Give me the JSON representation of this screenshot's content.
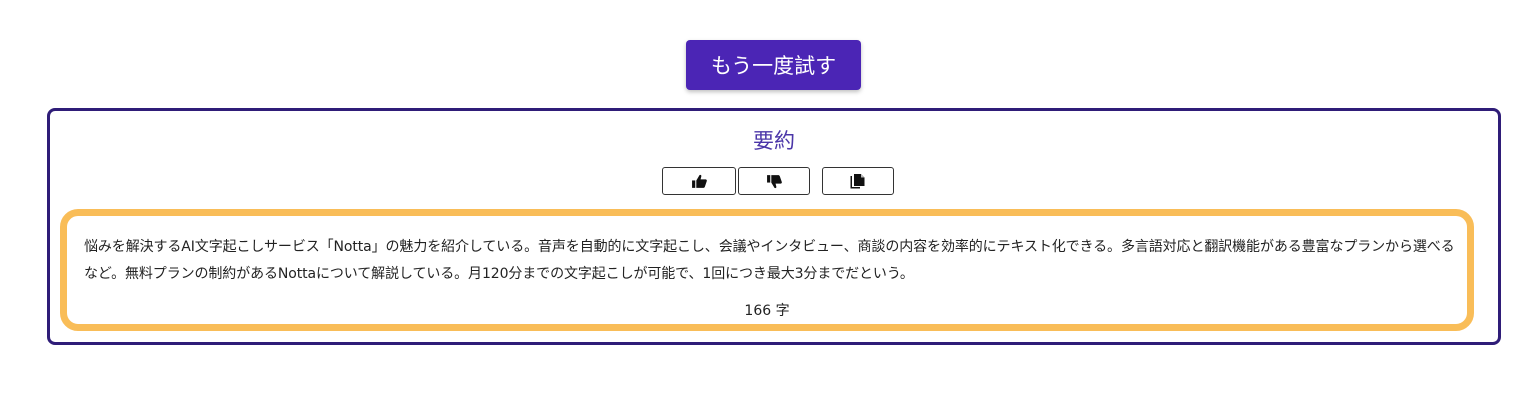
{
  "retry": {
    "label": "もう一度試す"
  },
  "summary": {
    "title": "要約",
    "text": "悩みを解決するAI文字起こしサービス「Notta」の魅力を紹介している。音声を自動的に文字起こし、会議やインタビュー、商談の内容を効率的にテキスト化できる。多言語対応と翻訳機能がある豊富なプランから選べるなど。無料プランの制約があるNottaについて解説している。月120分までの文字起こしが可能で、1回につき最大3分までだという。",
    "char_count": "166 字",
    "actions": {
      "like_icon": "thumbs-up-icon",
      "dislike_icon": "thumbs-down-icon",
      "copy_icon": "copy-icon"
    }
  },
  "colors": {
    "primary": "#4b25b5",
    "card_border": "#2f1d78",
    "highlight_border": "#f9bd58",
    "title_text": "#4b36a8"
  }
}
